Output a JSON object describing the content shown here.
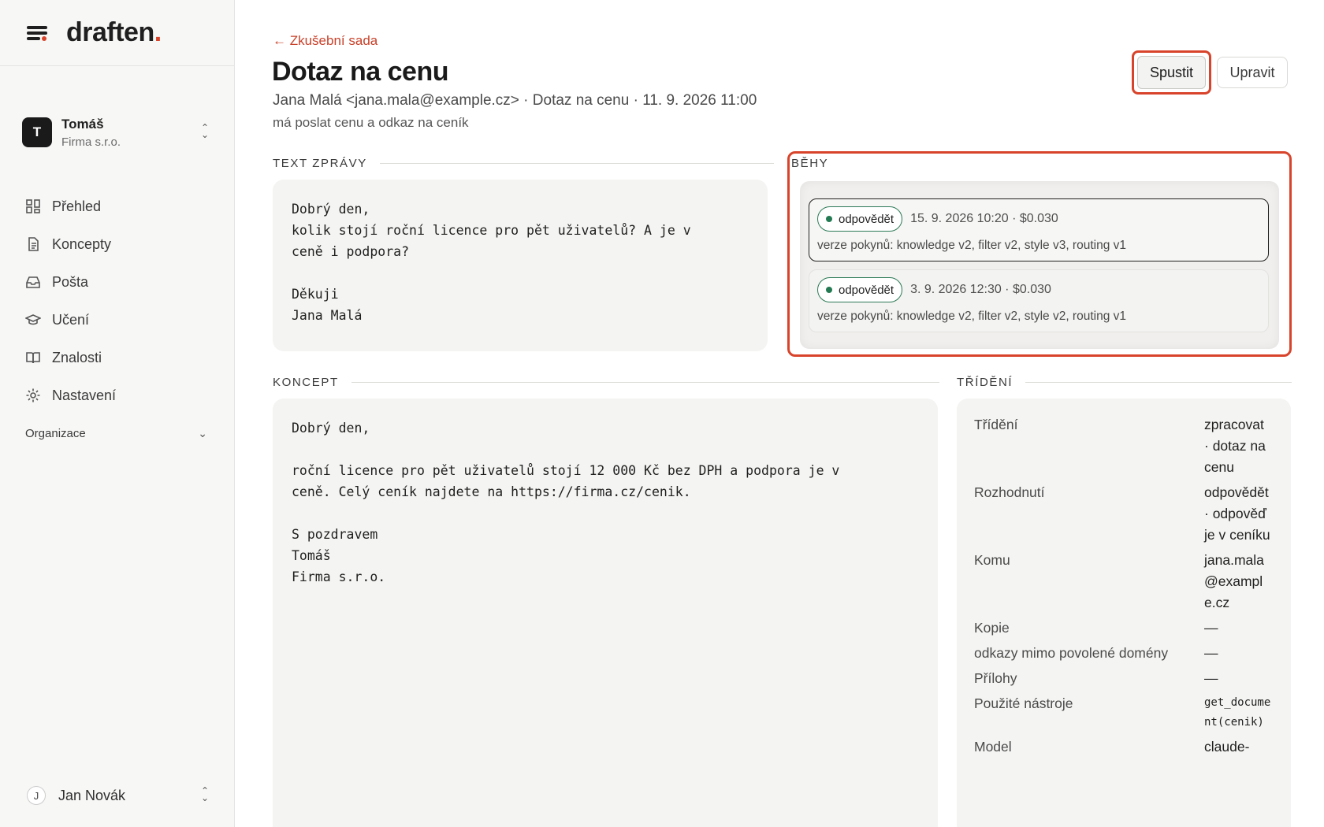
{
  "brand": {
    "name": "draften",
    "dot": "."
  },
  "account": {
    "initial": "T",
    "name": "Tomáš",
    "org": "Firma s.r.o."
  },
  "nav": [
    {
      "label": "Přehled",
      "icon": "grid-icon"
    },
    {
      "label": "Koncepty",
      "icon": "document-icon"
    },
    {
      "label": "Pošta",
      "icon": "inbox-icon"
    },
    {
      "label": "Učení",
      "icon": "graduation-cap-icon"
    },
    {
      "label": "Znalosti",
      "icon": "book-icon"
    },
    {
      "label": "Nastavení",
      "icon": "gear-icon"
    }
  ],
  "org_group": {
    "label": "Organizace"
  },
  "user": {
    "initial": "J",
    "name": "Jan Novák"
  },
  "header": {
    "back": "← Zkušební sada",
    "title": "Dotaz na cenu",
    "meta": "Jana Malá <jana.mala@example.cz> · Dotaz na cenu · 11. 9. 2026 11:00",
    "note": "má poslat cenu a odkaz na ceník",
    "run_button": "Spustit",
    "edit_button": "Upravit"
  },
  "message": {
    "label": "TEXT ZPRÁVY",
    "body": "Dobrý den,\nkolik stojí roční licence pro pět uživatelů? A je v\nceně i podpora?\n\nDěkuji\nJana Malá"
  },
  "runs": {
    "label": "BĚHY",
    "items": [
      {
        "status": "odpovědět",
        "when": "15. 9. 2026 10:20 · $0.030",
        "versions": "verze pokynů: knowledge v2, filter v2, style v3, routing v1"
      },
      {
        "status": "odpovědět",
        "when": "3. 9. 2026 12:30 · $0.030",
        "versions": "verze pokynů: knowledge v2, filter v2, style v2, routing v1"
      }
    ]
  },
  "draft": {
    "label": "KONCEPT",
    "body": "Dobrý den,\n\nroční licence pro pět uživatelů stojí 12 000 Kč bez DPH a podpora je v\nceně. Celý ceník najdete na https://firma.cz/cenik.\n\nS pozdravem\nTomáš\nFirma s.r.o."
  },
  "triage": {
    "label": "TŘÍDĚNÍ",
    "rows": [
      {
        "key": "Třídění",
        "value": "zpracovat · dotaz na cenu"
      },
      {
        "key": "Rozhodnutí",
        "value": "odpovědět · odpověď je v ceníku"
      },
      {
        "key": "Komu",
        "value": "jana.mala@example.cz"
      },
      {
        "key": "Kopie",
        "value": "—"
      },
      {
        "key": "odkazy mimo povolené domény",
        "value": "—"
      },
      {
        "key": "Přílohy",
        "value": "—"
      },
      {
        "key": "Použité nástroje",
        "value": "get_document(cenik)"
      },
      {
        "key": "Model",
        "value": "claude-"
      }
    ]
  },
  "colors": {
    "accent": "#d8442b",
    "status_green": "#237a52"
  }
}
